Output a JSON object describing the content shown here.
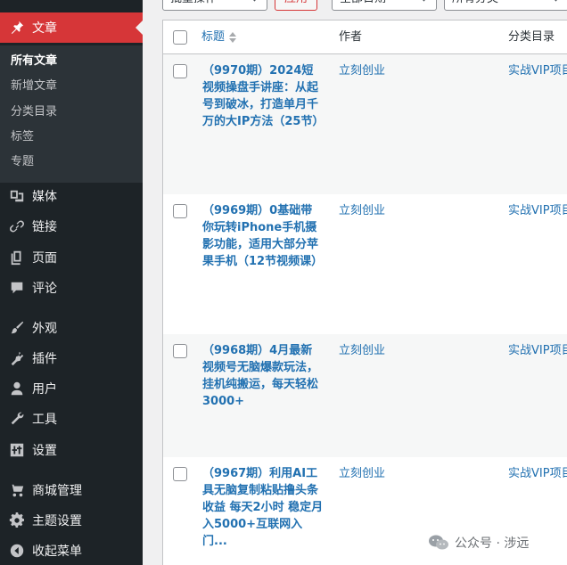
{
  "sidebar": {
    "posts": {
      "label": "文章"
    },
    "submenu": [
      {
        "label": "所有文章"
      },
      {
        "label": "新增文章"
      },
      {
        "label": "分类目录"
      },
      {
        "label": "标签"
      },
      {
        "label": "专题"
      }
    ],
    "items": [
      {
        "label": "媒体"
      },
      {
        "label": "链接"
      },
      {
        "label": "页面"
      },
      {
        "label": "评论"
      },
      {
        "label": "外观"
      },
      {
        "label": "插件"
      },
      {
        "label": "用户"
      },
      {
        "label": "工具"
      },
      {
        "label": "设置"
      },
      {
        "label": "商城管理"
      },
      {
        "label": "主题设置"
      },
      {
        "label": "收起菜单"
      }
    ]
  },
  "filters": {
    "bulk_actions": "批量操作",
    "apply": "应用",
    "dates": "全部日期",
    "categories": "所有分类"
  },
  "table": {
    "columns": {
      "title": "标题",
      "author": "作者",
      "category": "分类目录"
    },
    "rows": [
      {
        "title": "（9970期）2024短视频操盘手讲座：从起号到破冰，打造单月千万的大IP方法（25节）",
        "author": "立刻创业",
        "category": "实战VIP项目"
      },
      {
        "title": "（9969期）0基础带你玩转iPhone手机摄影功能，适用大部分苹果手机（12节视频课）",
        "author": "立刻创业",
        "category": "实战VIP项目"
      },
      {
        "title": "（9968期）4月最新视频号无脑爆款玩法，挂机纯搬运，每天轻松3000+",
        "author": "立刻创业",
        "category": "实战VIP项目"
      },
      {
        "title": "（9967期）利用AI工具无脑复制粘贴撸头条收益 每天2小时 稳定月入5000+互联网入门...",
        "author": "立刻创业",
        "category": "实战VIP项目"
      }
    ]
  },
  "watermark": {
    "text": "公众号 · 涉远"
  }
}
